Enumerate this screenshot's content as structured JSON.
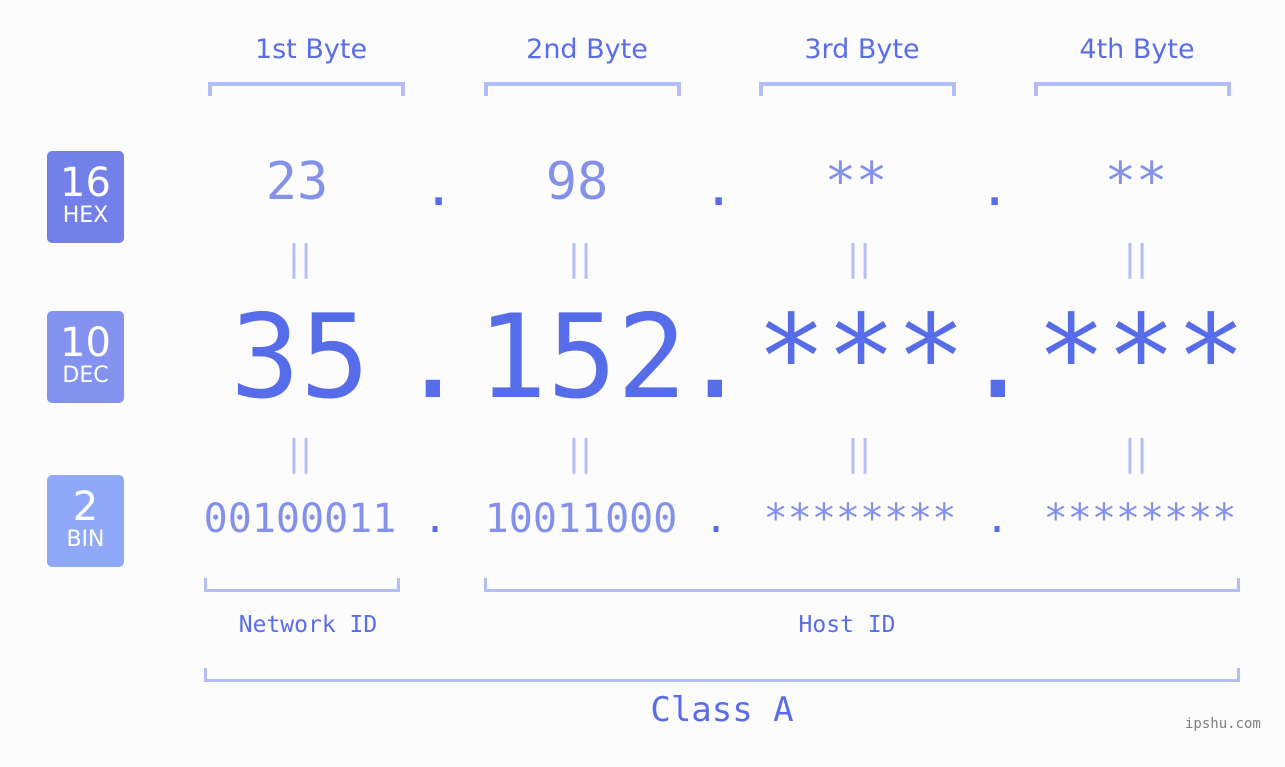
{
  "badges": [
    {
      "num": "16",
      "label": "HEX",
      "color": "#7380ea"
    },
    {
      "num": "10",
      "label": "DEC",
      "color": "#8492f0"
    },
    {
      "num": "2",
      "label": "BIN",
      "color": "#8fa8f8"
    }
  ],
  "headers": [
    "1st Byte",
    "2nd Byte",
    "3rd Byte",
    "4th Byte"
  ],
  "hex": [
    "23",
    "98",
    "**",
    "**"
  ],
  "dec": [
    "35",
    "152",
    "***",
    "***"
  ],
  "bin": [
    "00100011",
    "10011000",
    "********",
    "********"
  ],
  "separator": ".",
  "equals": "||",
  "network_label": "Network ID",
  "host_label": "Host ID",
  "class_label": "Class A",
  "watermark": "ipshu.com",
  "colors": {
    "primary": "#566ce9",
    "light": "#8491ea",
    "bracket": "#b3bdf6"
  }
}
